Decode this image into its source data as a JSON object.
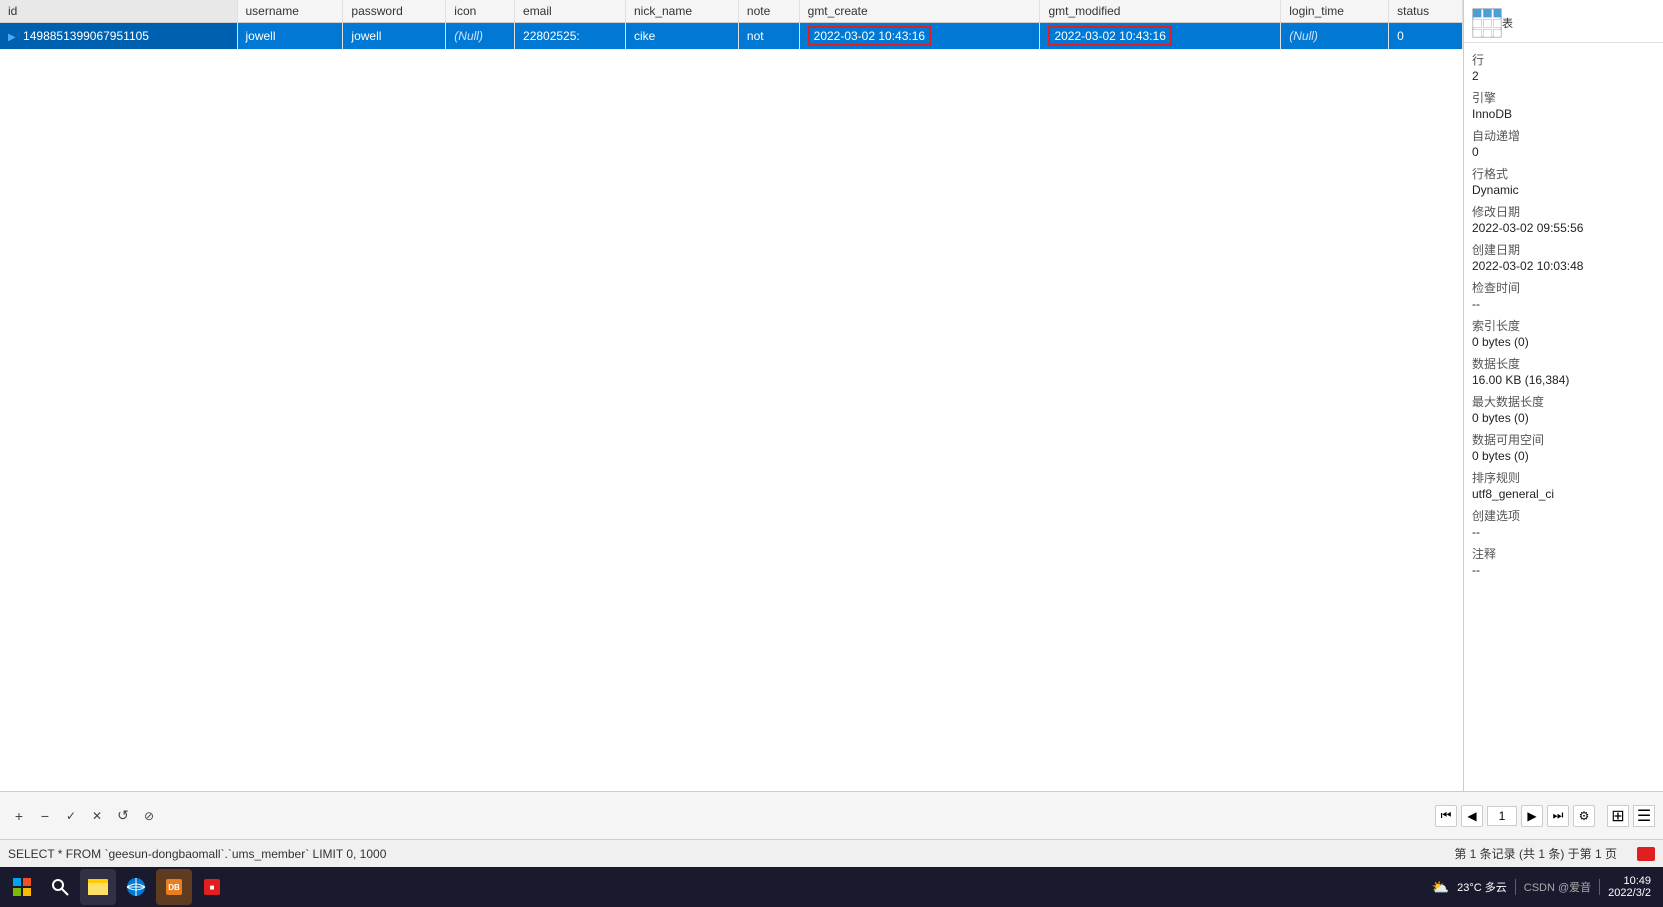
{
  "table": {
    "columns": [
      {
        "id": "col-id",
        "label": "id"
      },
      {
        "id": "col-username",
        "label": "username"
      },
      {
        "id": "col-password",
        "label": "password"
      },
      {
        "id": "col-icon",
        "label": "icon"
      },
      {
        "id": "col-email",
        "label": "email"
      },
      {
        "id": "col-nick-name",
        "label": "nick_name"
      },
      {
        "id": "col-note",
        "label": "note"
      },
      {
        "id": "col-gmt-create",
        "label": "gmt_create"
      },
      {
        "id": "col-gmt-modified",
        "label": "gmt_modified"
      },
      {
        "id": "col-login-time",
        "label": "login_time"
      },
      {
        "id": "col-status",
        "label": "status"
      }
    ],
    "rows": [
      {
        "id": "1498851399067951105",
        "username": "jowell",
        "password": "jowell",
        "icon": "(Null)",
        "email": "22802525:",
        "nick_name": "cike",
        "note": "not",
        "gmt_create": "2022-03-02 10:43:16",
        "gmt_modified": "2022-03-02 10:43:16",
        "login_time": "(Null)",
        "status": "0",
        "selected": true
      }
    ]
  },
  "right_panel": {
    "title": "表",
    "icon_label": "table-grid-icon",
    "stats": [
      {
        "label": "行",
        "value": "2"
      },
      {
        "label": "引擎",
        "value": "InnoDB"
      },
      {
        "label": "自动递增",
        "value": "0"
      },
      {
        "label": "行格式",
        "value": "Dynamic"
      },
      {
        "label": "修改日期",
        "value": "2022-03-02 09:55:56"
      },
      {
        "label": "创建日期",
        "value": "2022-03-02 10:03:48"
      },
      {
        "label": "检查时间",
        "value": "--"
      },
      {
        "label": "索引长度",
        "value": "0 bytes (0)"
      },
      {
        "label": "数据长度",
        "value": "16.00 KB (16,384)"
      },
      {
        "label": "最大数据长度",
        "value": "0 bytes (0)"
      },
      {
        "label": "数据可用空间",
        "value": "0 bytes (0)"
      },
      {
        "label": "排序规则",
        "value": "utf8_general_ci"
      },
      {
        "label": "创建选项",
        "value": "--"
      },
      {
        "label": "注释",
        "value": "--"
      }
    ]
  },
  "toolbar": {
    "buttons": [
      {
        "id": "add",
        "label": "+",
        "title": "Add"
      },
      {
        "id": "remove",
        "label": "−",
        "title": "Remove"
      },
      {
        "id": "check",
        "label": "✓",
        "title": "Apply"
      },
      {
        "id": "cancel",
        "label": "✕",
        "title": "Cancel"
      },
      {
        "id": "refresh",
        "label": "↺",
        "title": "Refresh"
      },
      {
        "id": "stop",
        "label": "⊘",
        "title": "Stop"
      }
    ]
  },
  "pagination": {
    "first_label": "⏮",
    "prev_label": "◀",
    "current_page": "1",
    "next_label": "▶",
    "last_label": "⏭",
    "settings_label": "⚙"
  },
  "status_bar": {
    "sql": "SELECT * FROM `geesun-dongbaomall`.`ums_member` LIMIT 0, 1000",
    "page_info": "第 1 条记录 (共 1 条) 于第 1 页"
  },
  "taskbar": {
    "weather": "23°C  多云",
    "time": "10:49",
    "date": "2022/3/2"
  },
  "colors": {
    "selected_row_bg": "#0078d4",
    "header_bg": "#f5f5f5",
    "gmt_create_border": "#e02020",
    "gmt_modified_border": "#e02020",
    "status_bar_red": "#e02020"
  }
}
